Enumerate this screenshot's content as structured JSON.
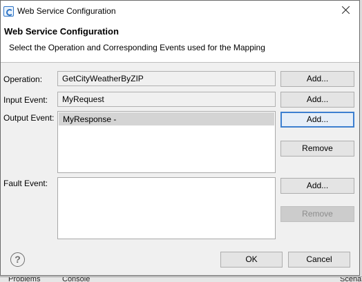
{
  "window": {
    "title": "Web Service Configuration",
    "icon": "app-icon",
    "close_icon": "close-icon"
  },
  "banner": {
    "title": "Web Service Configuration",
    "subtitle": "Select the Operation and Corresponding Events used for the Mapping"
  },
  "form": {
    "operation": {
      "label": "Operation:",
      "value": "GetCityWeatherByZIP",
      "add_label": "Add..."
    },
    "input_event": {
      "label": "Input Event:",
      "value": "MyRequest",
      "add_label": "Add..."
    },
    "output_event": {
      "label": "Output Event:",
      "items": [
        "MyResponse -"
      ],
      "add_label": "Add...",
      "remove_label": "Remove"
    },
    "fault_event": {
      "label": "Fault Event:",
      "items": [],
      "add_label": "Add...",
      "remove_label": "Remove"
    }
  },
  "footer": {
    "help_icon": "help-icon",
    "help_glyph": "?",
    "ok_label": "OK",
    "cancel_label": "Cancel"
  },
  "background_tabs": {
    "problems": "Problems",
    "console": "Console",
    "scenarios": "Scenar"
  },
  "colors": {
    "dialog_bg": "#f0f0f0",
    "focus_border": "#3c7fd0",
    "selected_row": "#d4d4d4"
  }
}
